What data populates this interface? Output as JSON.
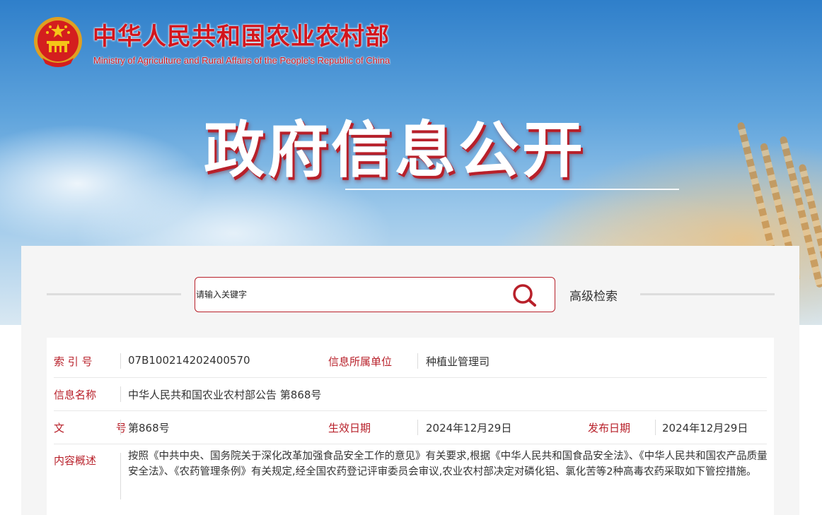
{
  "header": {
    "ministry_cn": "中华人民共和国农业农村部",
    "ministry_en": "Ministry of Agriculture and Rural Affairs of the People's Republic of China",
    "emblem_icon": "national-emblem-icon",
    "hero_title": "政府信息公开"
  },
  "search": {
    "placeholder": "请输入关键字",
    "button_icon": "search-icon",
    "advanced_label": "高级检索"
  },
  "info": {
    "index_label": "索 引 号",
    "index_value": "07B100214202400570",
    "unit_label": "信息所属单位",
    "unit_value": "种植业管理司",
    "name_label": "信息名称",
    "name_value": "中华人民共和国农业农村部公告 第868号",
    "doc_label": "文 号",
    "doc_value": "第868号",
    "effective_label": "生效日期",
    "effective_value": "2024年12月29日",
    "publish_label": "发布日期",
    "publish_value": "2024年12月29日",
    "summary_label": "内容概述",
    "summary_value": "按照《中共中央、国务院关于深化改革加强食品安全工作的意见》有关要求,根据《中华人民共和国食品安全法》、《中华人民共和国农产品质量安全法》、《农药管理条例》有关规定,经全国农药登记评审委员会审议,农业农村部决定对磷化铝、氯化苦等2种高毒农药采取如下管控措施。"
  },
  "colors": {
    "brand_red": "#d3161d",
    "label_red": "#b8202a"
  }
}
